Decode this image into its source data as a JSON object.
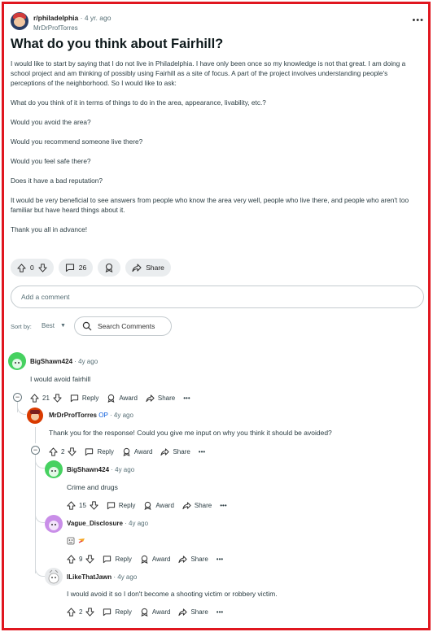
{
  "post": {
    "subreddit": "r/philadelphia",
    "age": "· 4 yr. ago",
    "author": "MrDrProfTorres",
    "title": "What do you think about Fairhill?",
    "paragraphs": [
      "I would like to start by saying that I do not live in Philadelphia. I have only been once so my knowledge is not that great. I am doing a school project and am thinking of possibly using Fairhill as a site of focus. A part of the project involves understanding people's perceptions of the neighborhood. So I would like to ask:",
      "What do you think of it in terms of things to do in the area, appearance, livability, etc.?",
      "Would you avoid the area?",
      "Would you recommend someone live there?",
      "Would you feel safe there?",
      "Does it have a bad reputation?",
      "It would be very beneficial to see answers from people who know the area very well, people who live there, and people who aren't too familiar but have heard things about it.",
      "Thank you all in advance!"
    ],
    "votes": "0",
    "comment_count": "26",
    "share_label": "Share"
  },
  "comment_box": {
    "placeholder": "Add a comment"
  },
  "sort": {
    "label": "Sort by:",
    "value": "Best"
  },
  "search": {
    "placeholder": "Search Comments"
  },
  "labels": {
    "reply": "Reply",
    "award": "Award",
    "share": "Share",
    "op": "OP"
  },
  "comments": [
    {
      "user": "BigShawn424",
      "age": "· 4y ago",
      "text": "I would avoid fairhill",
      "votes": "21",
      "avatar_color": "#46d160"
    },
    {
      "user": "MrDrProfTorres",
      "age": "· 4y ago",
      "text": "Thank you for the response! Could you give me input on why you think it should be avoided?",
      "votes": "2",
      "avatar_color": "#d93a00"
    },
    {
      "user": "BigShawn424",
      "age": "· 4y ago",
      "text": "Crime and drugs",
      "votes": "15",
      "avatar_color": "#46d160"
    },
    {
      "user": "Vague_Disclosure",
      "age": "· 4y ago",
      "text": "",
      "votes": "9",
      "avatar_color": "#c98ee8"
    },
    {
      "user": "ILikeThatJawn",
      "age": "· 4y ago",
      "text": "I would avoid it so I don't become a shooting victim or robbery victim.",
      "votes": "2",
      "avatar_color": "#c8ccd0"
    }
  ]
}
